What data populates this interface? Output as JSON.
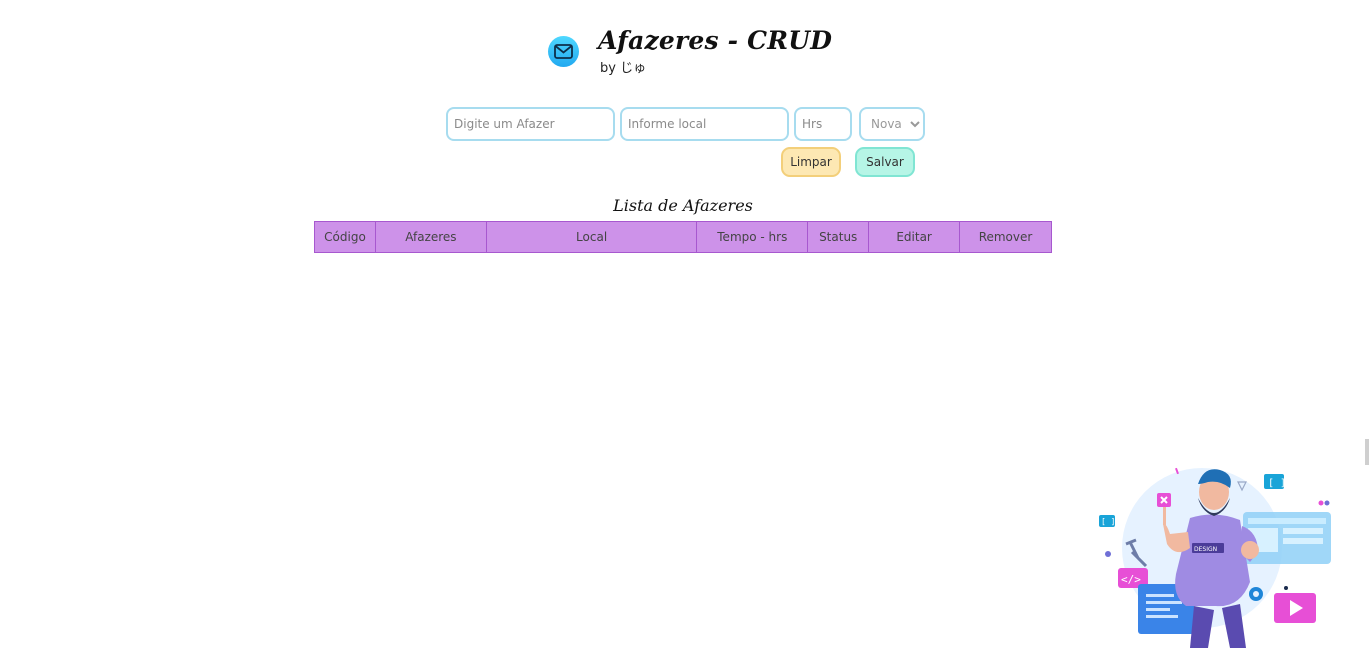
{
  "header": {
    "title": "Afazeres - CRUD",
    "byline": "by じゅ",
    "icon": "mail-icon"
  },
  "form": {
    "afazer_placeholder": "Digite um Afazer",
    "local_placeholder": "Informe local",
    "hrs_placeholder": "Hrs",
    "status_selected": "Nova",
    "limpar_label": "Limpar",
    "salvar_label": "Salvar"
  },
  "list": {
    "title": "Lista de Afazeres",
    "columns": [
      "Código",
      "Afazeres",
      "Local",
      "Tempo - hrs",
      "Status",
      "Editar",
      "Remover"
    ]
  },
  "illustration": {
    "badge_text": "DESIGN"
  },
  "colors": {
    "table_header": "#cd92e9",
    "limpar_bg": "#fde8b3",
    "salvar_bg": "#b6f5e6",
    "input_border": "#a7dcef"
  }
}
